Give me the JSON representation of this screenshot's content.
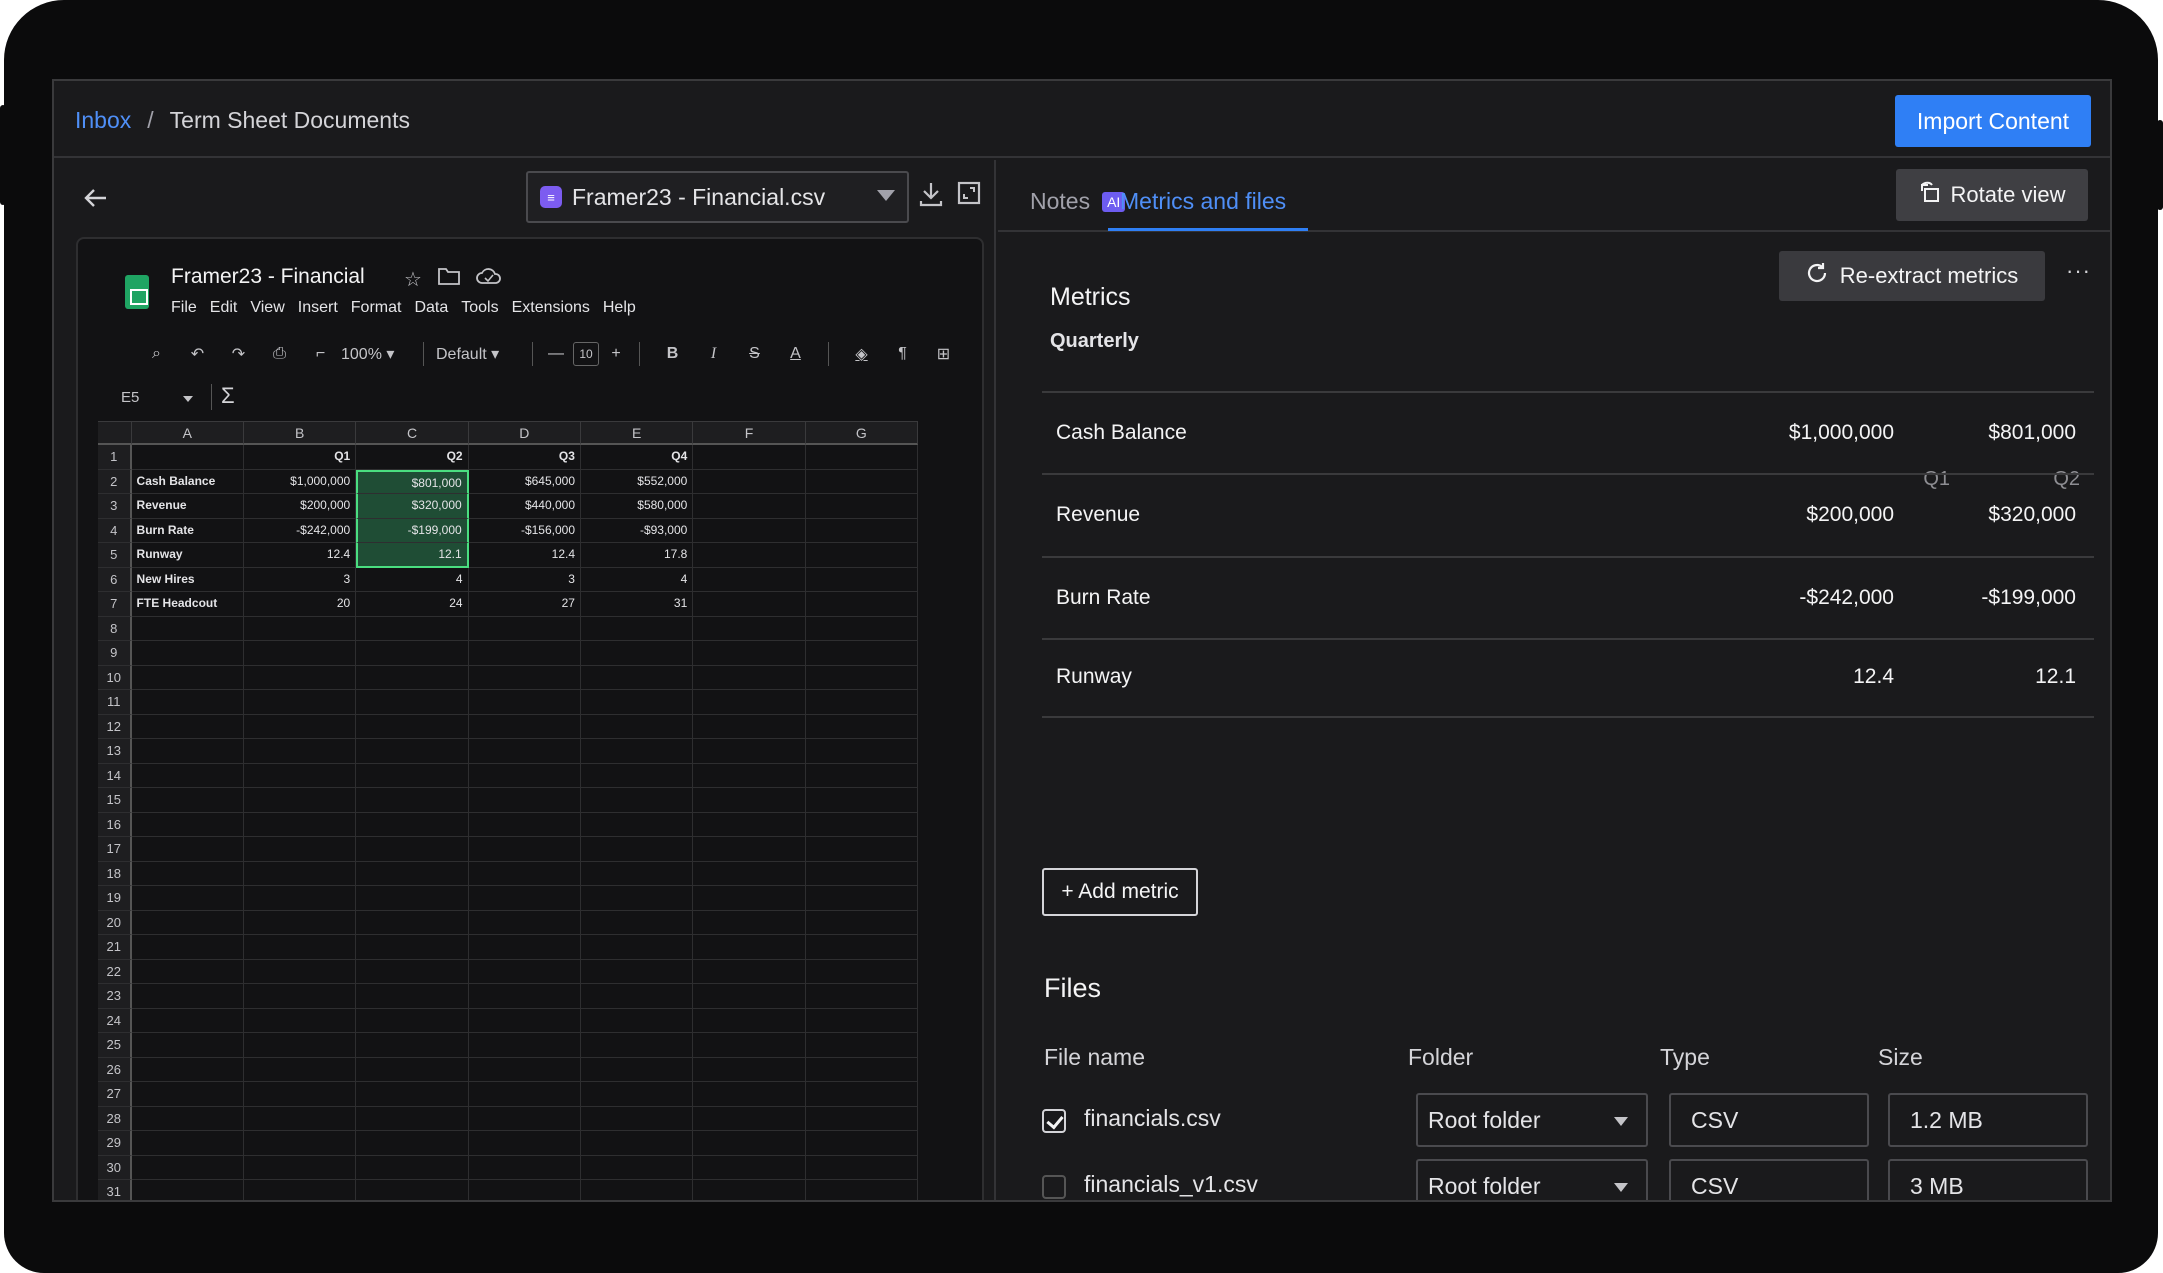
{
  "breadcrumb": {
    "root": "Inbox",
    "separator": "/",
    "current": "Term Sheet Documents"
  },
  "header": {
    "import_label": "Import Content"
  },
  "viewer": {
    "file_select": "Framer23 - Financial.csv",
    "icons": [
      "arrow-left-icon",
      "download-icon",
      "expand-icon"
    ]
  },
  "spreadsheet": {
    "title": "Framer23 - Financial",
    "menu": [
      "File",
      "Edit",
      "View",
      "Insert",
      "Format",
      "Data",
      "Tools",
      "Extensions",
      "Help"
    ],
    "zoom": "100%",
    "font": "Default",
    "font_size": "10",
    "name_box": "E5",
    "columns": [
      "A",
      "B",
      "C",
      "D",
      "E",
      "F",
      "G"
    ],
    "rows": [
      [
        "",
        "Q1",
        "Q2",
        "Q3",
        "Q4",
        "",
        ""
      ],
      [
        "Cash Balance",
        "$1,000,000",
        "$801,000",
        "$645,000",
        "$552,000",
        "",
        ""
      ],
      [
        "Revenue",
        "$200,000",
        "$320,000",
        "$440,000",
        "$580,000",
        "",
        ""
      ],
      [
        "Burn Rate",
        "-$242,000",
        "-$199,000",
        "-$156,000",
        "-$93,000",
        "",
        ""
      ],
      [
        "Runway",
        "12.4",
        "12.1",
        "12.4",
        "17.8",
        "",
        ""
      ],
      [
        "New Hires",
        "3",
        "4",
        "3",
        "4",
        "",
        ""
      ],
      [
        "FTE Headcout",
        "20",
        "24",
        "27",
        "31",
        "",
        ""
      ]
    ],
    "row_count": 31
  },
  "tabs": {
    "notes": "Notes",
    "ai_badge": "AI",
    "metrics": "Metrics and files"
  },
  "rotate_label": "Rotate view",
  "metrics": {
    "heading": "Metrics",
    "reextract_label": "Re-extract metrics",
    "more_label": "···",
    "period": "Quarterly",
    "columns": [
      "Q1",
      "Q2"
    ],
    "rows": [
      {
        "label": "Cash Balance",
        "q1": "$1,000,000",
        "q2": "$801,000"
      },
      {
        "label": "Revenue",
        "q1": "$200,000",
        "q2": "$320,000"
      },
      {
        "label": "Burn Rate",
        "q1": "-$242,000",
        "q2": "-$199,000"
      },
      {
        "label": "Runway",
        "q1": "12.4",
        "q2": "12.1"
      }
    ],
    "add_label": "+ Add metric"
  },
  "files": {
    "heading": "Files",
    "headers": {
      "name": "File name",
      "folder": "Folder",
      "type": "Type",
      "size": "Size"
    },
    "rows": [
      {
        "checked": true,
        "name": "financials.csv",
        "folder": "Root folder",
        "type": "CSV",
        "size": "1.2 MB"
      },
      {
        "checked": false,
        "name": "financials_v1.csv",
        "folder": "Root folder",
        "type": "CSV",
        "size": "3 MB"
      }
    ]
  }
}
